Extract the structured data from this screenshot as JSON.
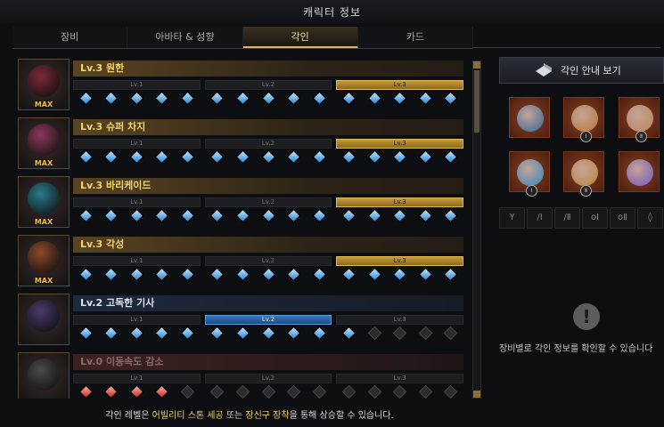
{
  "window": {
    "title": "캐릭터 정보"
  },
  "tabs": [
    {
      "label": "장비"
    },
    {
      "label": "아바타 & 성향"
    },
    {
      "label": "각인"
    },
    {
      "label": "카드"
    }
  ],
  "engravings": [
    {
      "title": "Lv.3 원한",
      "max_label": "MAX",
      "level": 3,
      "style": "gold",
      "levels": [
        "Lv.1",
        "Lv.2",
        "Lv.3"
      ],
      "gems": [
        "blue",
        "blue",
        "blue",
        "blue",
        "blue",
        "blue",
        "blue",
        "blue",
        "blue",
        "blue",
        "blue",
        "blue",
        "blue",
        "blue",
        "blue"
      ],
      "orb_color": "#7a2a3a"
    },
    {
      "title": "Lv.3 슈퍼 차지",
      "max_label": "MAX",
      "level": 3,
      "style": "gold",
      "levels": [
        "Lv.1",
        "Lv.2",
        "Lv.3"
      ],
      "gems": [
        "blue",
        "blue",
        "blue",
        "blue",
        "blue",
        "blue",
        "blue",
        "blue",
        "blue",
        "blue",
        "blue",
        "blue",
        "blue",
        "blue",
        "blue"
      ],
      "orb_color": "#8a3a5a"
    },
    {
      "title": "Lv.3 바리케이드",
      "max_label": "MAX",
      "level": 3,
      "style": "gold",
      "levels": [
        "Lv.1",
        "Lv.2",
        "Lv.3"
      ],
      "gems": [
        "blue",
        "blue",
        "blue",
        "blue",
        "blue",
        "blue",
        "blue",
        "blue",
        "blue",
        "blue",
        "blue",
        "blue",
        "blue",
        "blue",
        "blue"
      ],
      "orb_color": "#2a7a8a"
    },
    {
      "title": "Lv.3 각성",
      "max_label": "MAX",
      "level": 3,
      "style": "gold",
      "levels": [
        "Lv.1",
        "Lv.2",
        "Lv.3"
      ],
      "gems": [
        "blue",
        "blue",
        "blue",
        "blue",
        "blue",
        "blue",
        "blue",
        "blue",
        "blue",
        "blue",
        "blue",
        "blue",
        "blue",
        "blue",
        "blue"
      ],
      "orb_color": "#8a4a2a"
    },
    {
      "title": "Lv.2 고독한 기사",
      "max_label": "",
      "level": 2,
      "style": "blue",
      "levels": [
        "Lv.1",
        "Lv.2",
        "Lv.3"
      ],
      "gems": [
        "blue",
        "blue",
        "blue",
        "blue",
        "blue",
        "blue",
        "blue",
        "blue",
        "blue",
        "blue",
        "blue",
        "empty",
        "empty",
        "empty",
        "empty"
      ],
      "orb_color": "#4a3a6a"
    },
    {
      "title": "Lv.0 이동속도 감소",
      "max_label": "",
      "level": 0,
      "style": "red",
      "levels": [
        "Lv.1",
        "Lv.2",
        "Lv.3"
      ],
      "gems": [
        "red",
        "red",
        "red",
        "red",
        "empty",
        "empty",
        "empty",
        "empty",
        "empty",
        "empty",
        "empty",
        "empty",
        "empty",
        "empty",
        "empty"
      ],
      "orb_color": "#4a4a4a"
    }
  ],
  "guide": {
    "label": "각인 안내 보기",
    "icon": "book-icon"
  },
  "equipment": [
    {
      "name": "necklace-icon",
      "rank": "",
      "color": "#3a6aa0"
    },
    {
      "name": "earring-icon",
      "rank": "Ⅰ",
      "color": "#c07a3a"
    },
    {
      "name": "earring-icon",
      "rank": "Ⅱ",
      "color": "#c08a5a"
    },
    {
      "name": "ring-icon",
      "rank": "Ⅰ",
      "color": "#3a8ac0"
    },
    {
      "name": "ring-icon",
      "rank": "Ⅱ",
      "color": "#c08a3a"
    },
    {
      "name": "stone-icon",
      "rank": "",
      "color": "#7a5ac0"
    }
  ],
  "slot_icons": [
    "Y",
    "/Ⅰ",
    "/Ⅱ",
    "oⅠ",
    "oⅡ",
    "◊"
  ],
  "info_text": "장비별로 각인 정보를 확인할 수 있습니다",
  "footer": {
    "prefix": "각인 레벨은 ",
    "hl1": "어빌리티 스톤 세공",
    "mid": " 또는 ",
    "hl2": "장신구 장착",
    "suffix": "을 통해 상승할 수 있습니다."
  }
}
